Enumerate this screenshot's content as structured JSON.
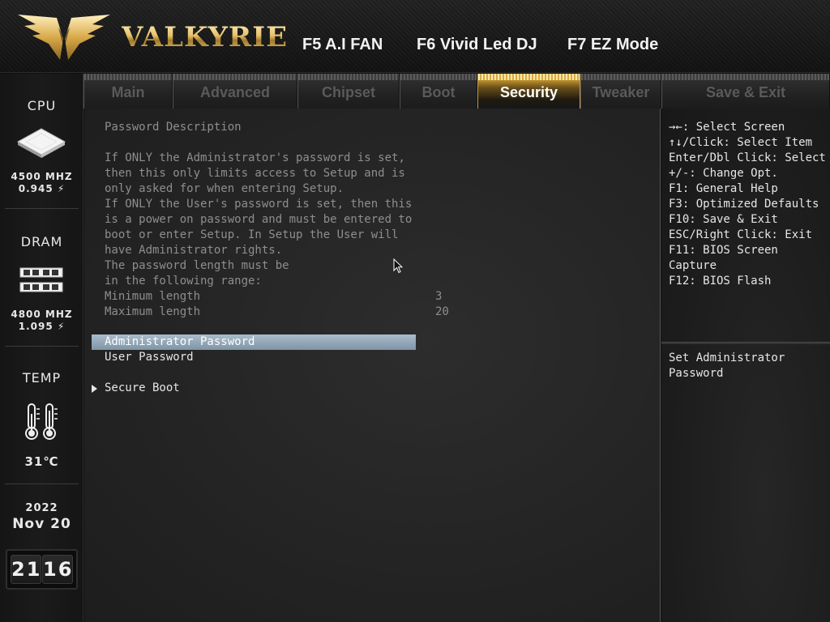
{
  "header": {
    "brand": "VALKYRIE",
    "hotkeys": [
      {
        "label": "F5 A.I FAN"
      },
      {
        "label": "F6 Vivid Led DJ"
      },
      {
        "label": "F7 EZ Mode"
      }
    ]
  },
  "sidebar": {
    "cpu": {
      "title": "CPU",
      "freq": "4500 MHZ",
      "volt": "0.945 ⚡"
    },
    "dram": {
      "title": "DRAM",
      "freq": "4800 MHZ",
      "volt": "1.095 ⚡"
    },
    "temp": {
      "title": "TEMP",
      "value": "31℃"
    },
    "date": {
      "year": "2022",
      "month_day": "Nov 20"
    },
    "clock": {
      "hour": "21",
      "minute": "16"
    }
  },
  "tabs": [
    {
      "label": "Main",
      "active": false
    },
    {
      "label": "Advanced",
      "active": false
    },
    {
      "label": "Chipset",
      "active": false
    },
    {
      "label": "Boot",
      "active": false
    },
    {
      "label": "Security",
      "active": true
    },
    {
      "label": "Tweaker",
      "active": false
    },
    {
      "label": "Save & Exit",
      "active": false
    }
  ],
  "main": {
    "description": [
      "Password Description",
      "",
      "If ONLY the Administrator's password is set,",
      "then this only limits access to Setup and is",
      "only asked for when entering Setup.",
      "If ONLY the User's password is set, then this",
      "is a power on password and must be entered to",
      "boot or enter Setup. In Setup the User will",
      "have Administrator rights.",
      "The password length must be",
      "in the following range:"
    ],
    "min_label": "Minimum length",
    "min_value": "3",
    "max_label": "Maximum length",
    "max_value": "20",
    "items": [
      {
        "label": "Administrator Password"
      },
      {
        "label": "User Password"
      },
      {
        "label": "Secure Boot"
      }
    ]
  },
  "help": {
    "keys": [
      "→←: Select Screen",
      "↑↓/Click: Select Item",
      "Enter/Dbl Click: Select",
      "+/-: Change Opt.",
      "F1: General Help",
      "F3: Optimized Defaults",
      "F10: Save & Exit",
      "ESC/Right Click: Exit",
      "F11: BIOS Screen",
      "Capture",
      "F12: BIOS Flash"
    ],
    "item_help": [
      "Set Administrator",
      "Password"
    ]
  },
  "colors": {
    "accent_gold": "#d9a534",
    "selection_bar": "#8fa5b6",
    "text_dim": "#8e8e8e",
    "text_bright": "#e6e6e6"
  },
  "icons": {
    "cpu": "cpu-chip-icon",
    "dram": "ram-module-icon",
    "temp": "thermometer-icon",
    "logo": "valkyrie-wings-logo"
  }
}
